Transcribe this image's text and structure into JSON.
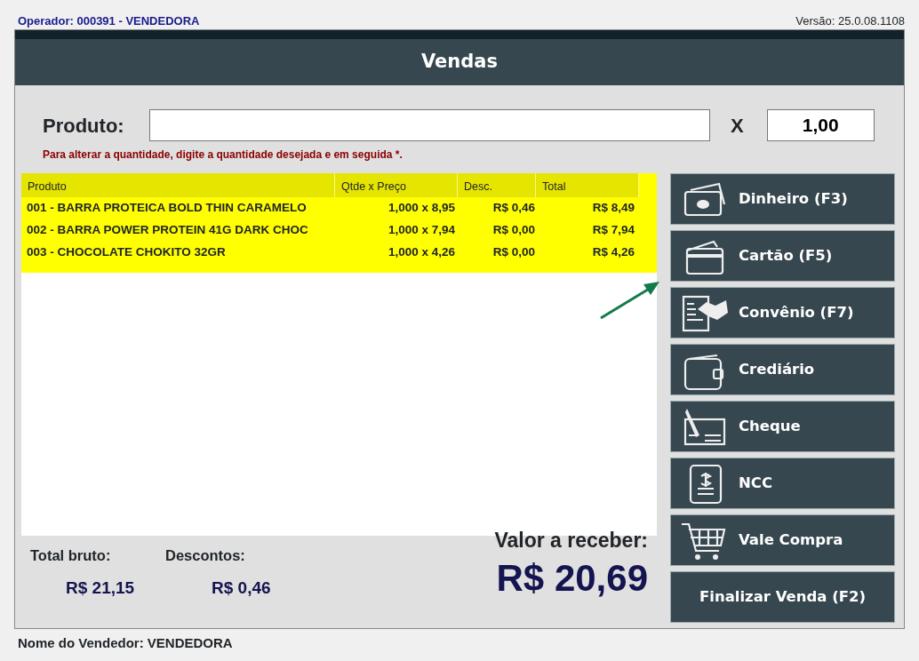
{
  "operator": "Operador: 000391 - VENDEDORA",
  "version": "Versão: 25.0.08.1108",
  "window": {
    "title": "Vendas"
  },
  "product_field": {
    "label": "Produto:"
  },
  "quantity": {
    "multiplier": "X",
    "value": "1,00"
  },
  "hint": "Para alterar a quantidade, digite a quantidade desejada e em seguida *.",
  "table": {
    "columns": [
      "Produto",
      "Qtde x Preço",
      "Desc.",
      "Total"
    ],
    "rows": [
      {
        "cells": [
          "001 - BARRA PROTEICA BOLD THIN CARAMELO",
          "1,000 x 8,95",
          "R$ 0,46",
          "R$ 8,49"
        ]
      },
      {
        "cells": [
          "002 - BARRA POWER PROTEIN 41G DARK CHOC",
          "1,000 x 7,94",
          "R$ 0,00",
          "R$ 7,94"
        ]
      },
      {
        "cells": [
          "003 - CHOCOLATE CHOKITO 32GR",
          "1,000 x 4,26",
          "R$ 0,00",
          "R$ 4,26"
        ]
      }
    ]
  },
  "payment_buttons": [
    {
      "kind": "cash",
      "label": "Dinheiro (F3)"
    },
    {
      "kind": "card",
      "label": "Cartão (F5)"
    },
    {
      "kind": "agreement",
      "label": "Convênio (F7)"
    },
    {
      "kind": "wallet",
      "label": "Crediário"
    },
    {
      "kind": "check",
      "label": "Cheque"
    },
    {
      "kind": "document",
      "label": "NCC"
    },
    {
      "kind": "cart",
      "label": "Vale Compra"
    },
    {
      "kind": "plain",
      "label": "Finalizar Venda (F2)"
    }
  ],
  "totals": {
    "gross_label": "Total bruto:",
    "gross_value": "R$ 21,15",
    "discount_label": "Descontos:",
    "discount_value": "R$ 0,46",
    "due_label": "Valor a receber:",
    "due_value": "R$ 20,69"
  },
  "status_bar": "Nome do Vendedor: VENDEDORA"
}
